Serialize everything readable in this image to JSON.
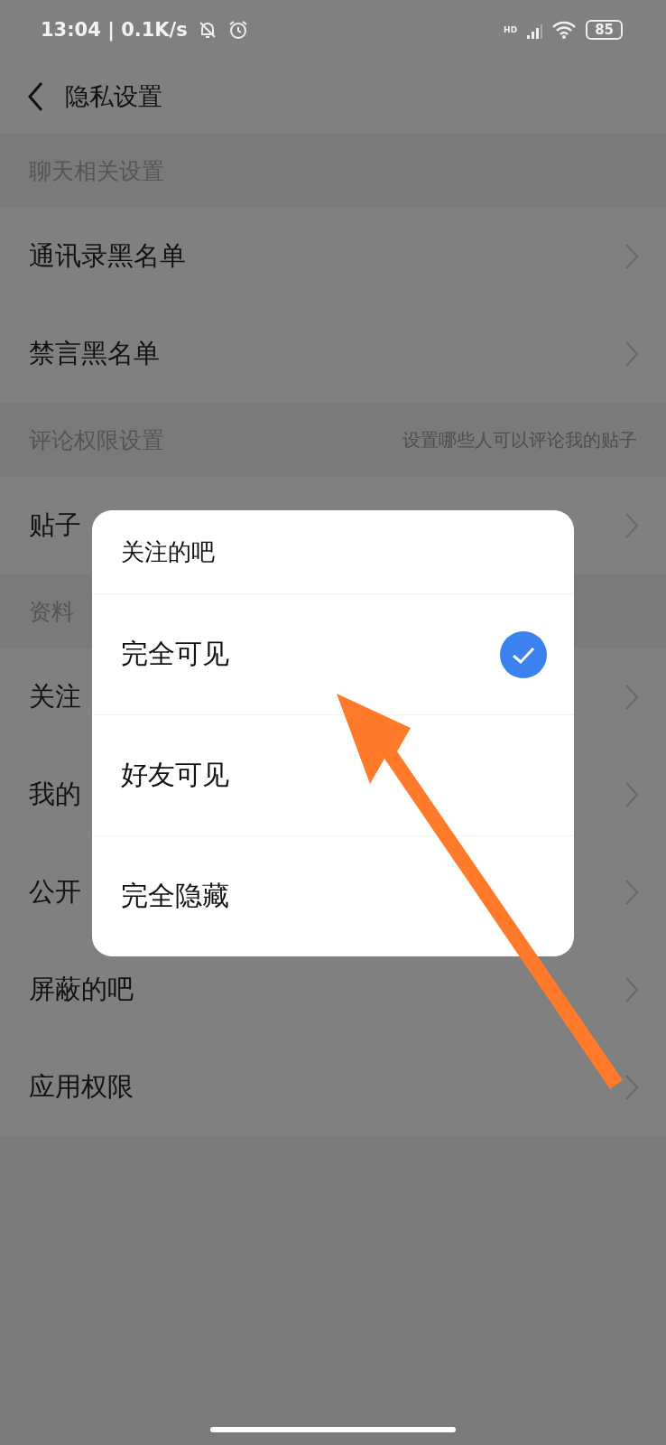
{
  "status_bar": {
    "time": "13:04 | 0.1K/s",
    "network": "HD",
    "battery": "85"
  },
  "header": {
    "title": "隐私设置"
  },
  "sections": [
    {
      "title": "聊天相关设置",
      "rows": [
        {
          "label": "通讯录黑名单"
        },
        {
          "label": "禁言黑名单"
        }
      ]
    },
    {
      "title": "评论权限设置",
      "hint": "设置哪些人可以评论我的贴子",
      "rows": [
        {
          "label": "贴子"
        }
      ]
    },
    {
      "title": "资料",
      "rows": [
        {
          "label": "关注"
        },
        {
          "label": "我的"
        },
        {
          "label": "公开"
        },
        {
          "label": "屏蔽的吧"
        },
        {
          "label": "应用权限"
        }
      ]
    }
  ],
  "dialog": {
    "title": "关注的吧",
    "options": [
      {
        "label": "完全可见",
        "selected": true
      },
      {
        "label": "好友可见",
        "selected": false
      },
      {
        "label": "完全隐藏",
        "selected": false
      }
    ]
  }
}
